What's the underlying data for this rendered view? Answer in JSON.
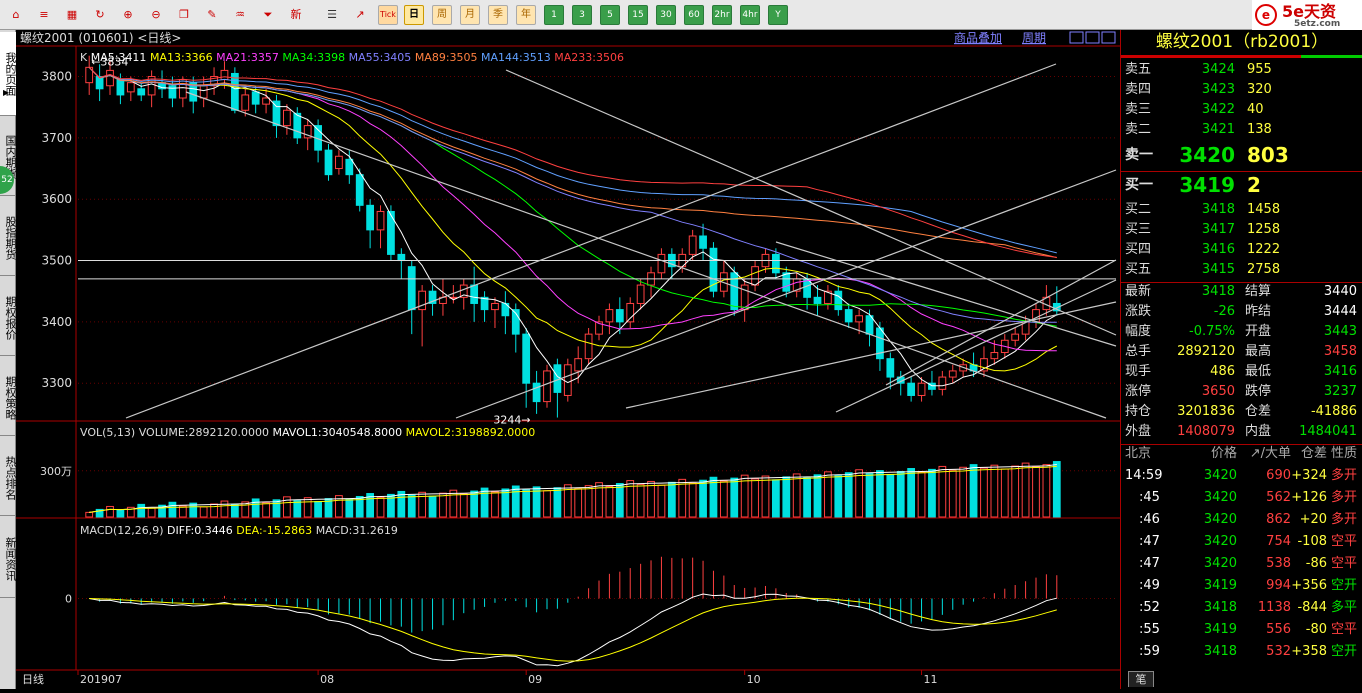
{
  "toolbar": {
    "period_buttons": [
      "日",
      "周",
      "月",
      "季",
      "年"
    ],
    "tick_label": "Tick",
    "new_label": "新",
    "min_buttons": [
      "1",
      "3",
      "5",
      "15",
      "30",
      "60",
      "2hr",
      "4hr",
      "Y"
    ]
  },
  "logo": {
    "brand": "5e天资",
    "url": "5etz.com"
  },
  "sidetabs": [
    "我的页面",
    "国内期货",
    "股指期货",
    "期权报价",
    "期权策略",
    "热点排名",
    "新闻资讯"
  ],
  "sidetab_badge": "52",
  "chart": {
    "title": "螺纹2001 (010601) <日线>",
    "links": [
      "商品叠加",
      "周期"
    ],
    "ma_header": {
      "prefix": "K",
      "items": [
        {
          "text": "MA5:3411",
          "color": "#ffffff"
        },
        {
          "text": "MA13:3366",
          "color": "#ffff00"
        },
        {
          "text": "MA21:3357",
          "color": "#ff40ff"
        },
        {
          "text": "MA34:3398",
          "color": "#00ff00"
        },
        {
          "text": "MA55:3405",
          "color": "#8080ff"
        },
        {
          "text": "MA89:3505",
          "color": "#ff8040"
        },
        {
          "text": "MA144:3513",
          "color": "#60a0ff"
        },
        {
          "text": "MA233:3506",
          "color": "#ff4040"
        }
      ]
    },
    "price_axis": [
      "3800",
      "3700",
      "3600",
      "3500",
      "3400",
      "3300"
    ],
    "high_label": "←3834",
    "low_label": "3244→",
    "vol_header": {
      "items": [
        {
          "text": "VOL(5,13)",
          "color": "#dddddd"
        },
        {
          "text": "VOLUME:2892120.0000",
          "color": "#dddddd"
        },
        {
          "text": "MAVOL1:3040548.8000",
          "color": "#ffffff"
        },
        {
          "text": "MAVOL2:3198892.0000",
          "color": "#ffff00"
        }
      ]
    },
    "vol_axis": "300万",
    "macd_header": {
      "items": [
        {
          "text": "MACD(12,26,9)",
          "color": "#dddddd"
        },
        {
          "text": "DIFF:0.3446",
          "color": "#ffffff"
        },
        {
          "text": "DEA:-15.2863",
          "color": "#ffff00"
        },
        {
          "text": "MACD:31.2619",
          "color": "#dddddd"
        }
      ]
    },
    "macd_axis": "0",
    "period_label": "日线",
    "date_labels": [
      "201907",
      "08",
      "09",
      "10",
      "11"
    ]
  },
  "chart_data": {
    "type": "candlestick",
    "ylim": [
      3240,
      3840
    ],
    "candles": [
      [
        3790,
        3815,
        3770,
        3834
      ],
      [
        3800,
        3780,
        3760,
        3820
      ],
      [
        3785,
        3810,
        3770,
        3825
      ],
      [
        3795,
        3770,
        3755,
        3805
      ],
      [
        3775,
        3790,
        3760,
        3800
      ],
      [
        3780,
        3770,
        3760,
        3790
      ],
      [
        3770,
        3800,
        3750,
        3810
      ],
      [
        3790,
        3780,
        3765,
        3810
      ],
      [
        3785,
        3765,
        3750,
        3800
      ],
      [
        3765,
        3795,
        3750,
        3800
      ],
      [
        3790,
        3760,
        3740,
        3800
      ],
      [
        3765,
        3785,
        3750,
        3800
      ],
      [
        3785,
        3800,
        3770,
        3815
      ],
      [
        3795,
        3810,
        3780,
        3825
      ],
      [
        3805,
        3745,
        3740,
        3815
      ],
      [
        3745,
        3770,
        3735,
        3780
      ],
      [
        3775,
        3755,
        3740,
        3785
      ],
      [
        3755,
        3765,
        3740,
        3780
      ],
      [
        3760,
        3720,
        3700,
        3770
      ],
      [
        3720,
        3745,
        3705,
        3755
      ],
      [
        3740,
        3700,
        3690,
        3750
      ],
      [
        3700,
        3720,
        3680,
        3730
      ],
      [
        3720,
        3680,
        3660,
        3730
      ],
      [
        3680,
        3640,
        3630,
        3690
      ],
      [
        3650,
        3670,
        3640,
        3680
      ],
      [
        3665,
        3640,
        3625,
        3680
      ],
      [
        3640,
        3590,
        3580,
        3650
      ],
      [
        3590,
        3550,
        3520,
        3600
      ],
      [
        3550,
        3580,
        3520,
        3590
      ],
      [
        3580,
        3510,
        3500,
        3590
      ],
      [
        3510,
        3500,
        3470,
        3520
      ],
      [
        3490,
        3420,
        3380,
        3500
      ],
      [
        3420,
        3450,
        3360,
        3460
      ],
      [
        3450,
        3430,
        3410,
        3460
      ],
      [
        3430,
        3440,
        3410,
        3470
      ],
      [
        3440,
        3440,
        3430,
        3460
      ],
      [
        3440,
        3460,
        3420,
        3470
      ],
      [
        3460,
        3430,
        3400,
        3490
      ],
      [
        3440,
        3420,
        3400,
        3450
      ],
      [
        3420,
        3430,
        3390,
        3440
      ],
      [
        3430,
        3410,
        3380,
        3450
      ],
      [
        3420,
        3380,
        3350,
        3430
      ],
      [
        3380,
        3300,
        3260,
        3390
      ],
      [
        3300,
        3270,
        3250,
        3320
      ],
      [
        3270,
        3320,
        3260,
        3330
      ],
      [
        3330,
        3285,
        3244,
        3340
      ],
      [
        3280,
        3330,
        3270,
        3340
      ],
      [
        3320,
        3340,
        3300,
        3360
      ],
      [
        3340,
        3380,
        3330,
        3390
      ],
      [
        3380,
        3400,
        3370,
        3410
      ],
      [
        3400,
        3420,
        3380,
        3430
      ],
      [
        3420,
        3400,
        3380,
        3440
      ],
      [
        3400,
        3430,
        3390,
        3440
      ],
      [
        3430,
        3460,
        3420,
        3470
      ],
      [
        3460,
        3480,
        3440,
        3490
      ],
      [
        3480,
        3510,
        3470,
        3520
      ],
      [
        3510,
        3490,
        3470,
        3520
      ],
      [
        3490,
        3510,
        3480,
        3520
      ],
      [
        3510,
        3540,
        3500,
        3550
      ],
      [
        3540,
        3520,
        3500,
        3560
      ],
      [
        3520,
        3450,
        3440,
        3530
      ],
      [
        3450,
        3480,
        3440,
        3500
      ],
      [
        3480,
        3420,
        3410,
        3490
      ],
      [
        3420,
        3460,
        3400,
        3470
      ],
      [
        3460,
        3490,
        3450,
        3500
      ],
      [
        3490,
        3510,
        3480,
        3520
      ],
      [
        3510,
        3480,
        3470,
        3520
      ],
      [
        3480,
        3450,
        3440,
        3490
      ],
      [
        3450,
        3470,
        3440,
        3480
      ],
      [
        3470,
        3440,
        3420,
        3480
      ],
      [
        3440,
        3430,
        3410,
        3460
      ],
      [
        3430,
        3450,
        3420,
        3460
      ],
      [
        3450,
        3420,
        3410,
        3460
      ],
      [
        3420,
        3400,
        3390,
        3430
      ],
      [
        3400,
        3410,
        3380,
        3420
      ],
      [
        3410,
        3380,
        3360,
        3420
      ],
      [
        3390,
        3340,
        3320,
        3400
      ],
      [
        3340,
        3310,
        3290,
        3350
      ],
      [
        3310,
        3300,
        3280,
        3320
      ],
      [
        3300,
        3280,
        3270,
        3310
      ],
      [
        3280,
        3300,
        3270,
        3310
      ],
      [
        3300,
        3290,
        3280,
        3320
      ],
      [
        3290,
        3310,
        3280,
        3320
      ],
      [
        3310,
        3320,
        3300,
        3330
      ],
      [
        3320,
        3330,
        3310,
        3340
      ],
      [
        3330,
        3320,
        3310,
        3350
      ],
      [
        3320,
        3340,
        3310,
        3360
      ],
      [
        3340,
        3350,
        3330,
        3370
      ],
      [
        3350,
        3370,
        3340,
        3380
      ],
      [
        3370,
        3380,
        3360,
        3390
      ],
      [
        3380,
        3400,
        3370,
        3410
      ],
      [
        3400,
        3420,
        3390,
        3430
      ],
      [
        3420,
        3440,
        3410,
        3460
      ],
      [
        3430,
        3418,
        3410,
        3458
      ]
    ],
    "volume_max_wan": 500,
    "macd_range": [
      -90,
      80
    ]
  },
  "quote": {
    "title": "螺纹2001（rb2001）",
    "asks": [
      {
        "label": "卖五",
        "price": "3424",
        "vol": "955"
      },
      {
        "label": "卖四",
        "price": "3423",
        "vol": "320"
      },
      {
        "label": "卖三",
        "price": "3422",
        "vol": "40"
      },
      {
        "label": "卖二",
        "price": "3421",
        "vol": "138"
      }
    ],
    "ask1": {
      "label": "卖一",
      "price": "3420",
      "vol": "803"
    },
    "bid1": {
      "label": "买一",
      "price": "3419",
      "vol": "2"
    },
    "bids": [
      {
        "label": "买二",
        "price": "3418",
        "vol": "1458"
      },
      {
        "label": "买三",
        "price": "3417",
        "vol": "1258"
      },
      {
        "label": "买四",
        "price": "3416",
        "vol": "1222"
      },
      {
        "label": "买五",
        "price": "3415",
        "vol": "2758"
      }
    ],
    "stats": [
      {
        "l1": "最新",
        "v1": "3418",
        "c1": "grn",
        "l2": "结算",
        "v2": "3440",
        "c2": "wht"
      },
      {
        "l1": "涨跌",
        "v1": "-26",
        "c1": "grn",
        "l2": "昨结",
        "v2": "3444",
        "c2": "wht"
      },
      {
        "l1": "幅度",
        "v1": "-0.75%",
        "c1": "grn",
        "l2": "开盘",
        "v2": "3443",
        "c2": "grn"
      },
      {
        "l1": "总手",
        "v1": "2892120",
        "c1": "yel",
        "l2": "最高",
        "v2": "3458",
        "c2": "red"
      },
      {
        "l1": "现手",
        "v1": "486",
        "c1": "yel",
        "l2": "最低",
        "v2": "3416",
        "c2": "grn"
      },
      {
        "l1": "涨停",
        "v1": "3650",
        "c1": "red",
        "l2": "跌停",
        "v2": "3237",
        "c2": "grn"
      },
      {
        "l1": "持仓",
        "v1": "3201836",
        "c1": "yel",
        "l2": "仓差",
        "v2": "-41886",
        "c2": "yel"
      },
      {
        "l1": "外盘",
        "v1": "1408079",
        "c1": "red",
        "l2": "内盘",
        "v2": "1484041",
        "c2": "grn"
      }
    ],
    "tick_header": [
      "北京",
      "价格",
      "↗/大单",
      "仓差",
      "性质"
    ],
    "ticks": [
      {
        "t": "14:59",
        "p": "3420",
        "v": "690",
        "d": "+324",
        "k": "多开",
        "kc": "red"
      },
      {
        "t": ":45",
        "p": "3420",
        "v": "562",
        "d": "+126",
        "k": "多开",
        "kc": "red"
      },
      {
        "t": ":46",
        "p": "3420",
        "v": "862",
        "d": "+20",
        "k": "多开",
        "kc": "red"
      },
      {
        "t": ":47",
        "p": "3420",
        "v": "754",
        "d": "-108",
        "k": "空平",
        "kc": "red"
      },
      {
        "t": ":47",
        "p": "3420",
        "v": "538",
        "d": "-86",
        "k": "空平",
        "kc": "red"
      },
      {
        "t": ":49",
        "p": "3419",
        "v": "994",
        "d": "+356",
        "k": "空开",
        "kc": "grn"
      },
      {
        "t": ":52",
        "p": "3418",
        "v": "1138",
        "d": "-844",
        "k": "多平",
        "kc": "grn"
      },
      {
        "t": ":55",
        "p": "3419",
        "v": "556",
        "d": "-80",
        "k": "空平",
        "kc": "red"
      },
      {
        "t": ":59",
        "p": "3418",
        "v": "532",
        "d": "+358",
        "k": "空开",
        "kc": "grn"
      }
    ],
    "bottom_tab": "笔"
  }
}
